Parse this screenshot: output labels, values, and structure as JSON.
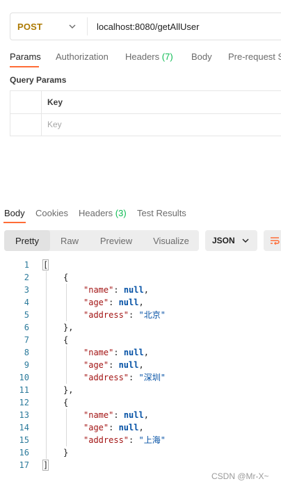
{
  "request": {
    "method": "POST",
    "url": "localhost:8080/getAllUser"
  },
  "request_tabs": [
    {
      "label": "Params",
      "active": true
    },
    {
      "label": "Authorization"
    },
    {
      "label": "Headers",
      "count": "(7)"
    },
    {
      "label": "Body"
    },
    {
      "label": "Pre-request S"
    }
  ],
  "query_params": {
    "title": "Query Params",
    "column_key": "Key",
    "key_placeholder": "Key"
  },
  "response_tabs": [
    {
      "label": "Body",
      "active": true
    },
    {
      "label": "Cookies"
    },
    {
      "label": "Headers",
      "count": "(3)"
    },
    {
      "label": "Test Results"
    }
  ],
  "view_modes": [
    "Pretty",
    "Raw",
    "Preview",
    "Visualize"
  ],
  "active_view": "Pretty",
  "format": "JSON",
  "code_lines": [
    {
      "n": "1",
      "indent": 0,
      "tokens": [
        [
          "punc",
          "["
        ]
      ]
    },
    {
      "n": "2",
      "indent": 1,
      "tokens": [
        [
          "punc",
          "{"
        ]
      ]
    },
    {
      "n": "3",
      "indent": 2,
      "tokens": [
        [
          "key",
          "\"name\""
        ],
        [
          "punc",
          ": "
        ],
        [
          "kw",
          "null"
        ],
        [
          "punc",
          ","
        ]
      ]
    },
    {
      "n": "4",
      "indent": 2,
      "tokens": [
        [
          "key",
          "\"age\""
        ],
        [
          "punc",
          ": "
        ],
        [
          "kw",
          "null"
        ],
        [
          "punc",
          ","
        ]
      ]
    },
    {
      "n": "5",
      "indent": 2,
      "tokens": [
        [
          "key",
          "\"address\""
        ],
        [
          "punc",
          ": "
        ],
        [
          "str",
          "\"北京\""
        ]
      ]
    },
    {
      "n": "6",
      "indent": 1,
      "tokens": [
        [
          "punc",
          "},"
        ]
      ]
    },
    {
      "n": "7",
      "indent": 1,
      "tokens": [
        [
          "punc",
          "{"
        ]
      ]
    },
    {
      "n": "8",
      "indent": 2,
      "tokens": [
        [
          "key",
          "\"name\""
        ],
        [
          "punc",
          ": "
        ],
        [
          "kw",
          "null"
        ],
        [
          "punc",
          ","
        ]
      ]
    },
    {
      "n": "9",
      "indent": 2,
      "tokens": [
        [
          "key",
          "\"age\""
        ],
        [
          "punc",
          ": "
        ],
        [
          "kw",
          "null"
        ],
        [
          "punc",
          ","
        ]
      ]
    },
    {
      "n": "10",
      "indent": 2,
      "tokens": [
        [
          "key",
          "\"address\""
        ],
        [
          "punc",
          ": "
        ],
        [
          "str",
          "\"深圳\""
        ]
      ]
    },
    {
      "n": "11",
      "indent": 1,
      "tokens": [
        [
          "punc",
          "},"
        ]
      ]
    },
    {
      "n": "12",
      "indent": 1,
      "tokens": [
        [
          "punc",
          "{"
        ]
      ]
    },
    {
      "n": "13",
      "indent": 2,
      "tokens": [
        [
          "key",
          "\"name\""
        ],
        [
          "punc",
          ": "
        ],
        [
          "kw",
          "null"
        ],
        [
          "punc",
          ","
        ]
      ]
    },
    {
      "n": "14",
      "indent": 2,
      "tokens": [
        [
          "key",
          "\"age\""
        ],
        [
          "punc",
          ": "
        ],
        [
          "kw",
          "null"
        ],
        [
          "punc",
          ","
        ]
      ]
    },
    {
      "n": "15",
      "indent": 2,
      "tokens": [
        [
          "key",
          "\"address\""
        ],
        [
          "punc",
          ": "
        ],
        [
          "str",
          "\"上海\""
        ]
      ]
    },
    {
      "n": "16",
      "indent": 1,
      "tokens": [
        [
          "punc",
          "}"
        ]
      ]
    },
    {
      "n": "17",
      "indent": 0,
      "tokens": [
        [
          "punc",
          "]"
        ]
      ]
    }
  ],
  "watermark": "CSDN @Mr-X~",
  "icons": {
    "method_dropdown": "chevron-down-icon",
    "format_dropdown": "chevron-down-icon",
    "wrap": "wrap-lines-icon"
  },
  "colors": {
    "accent": "#ff6c37",
    "method_post": "#ad7a03",
    "count": "#0cbb52",
    "json_key": "#a31515",
    "json_value": "#0451a5",
    "line_number": "#2b7a9b"
  }
}
